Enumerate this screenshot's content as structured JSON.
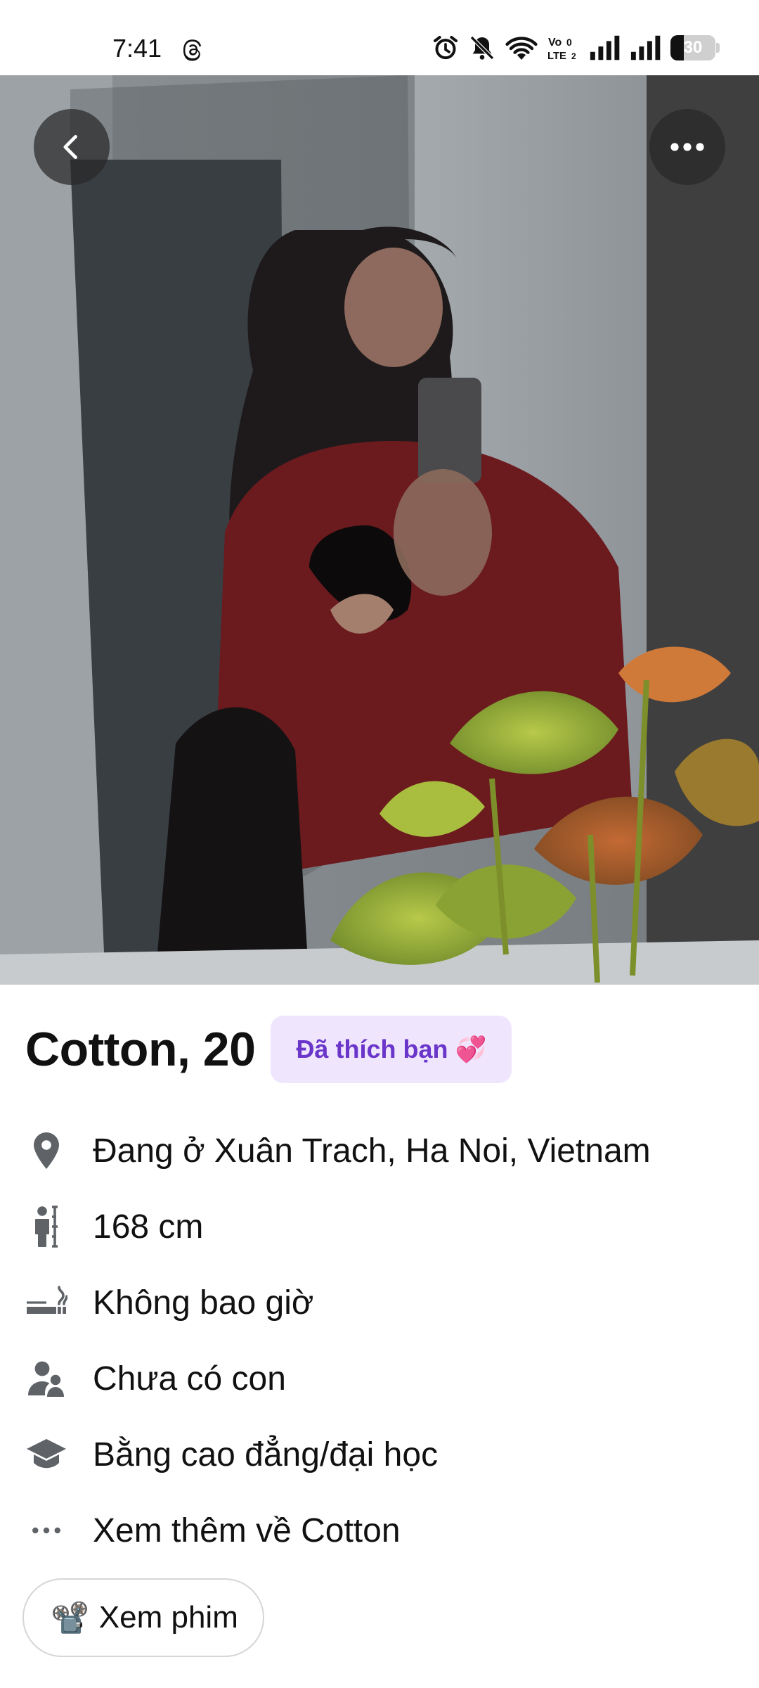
{
  "status_bar": {
    "time": "7:41",
    "battery": "30",
    "battery_level": 0.3,
    "icons": [
      "threads-icon",
      "alarm-icon",
      "mute-icon",
      "wifi-icon",
      "volte-icon",
      "signal-icon",
      "signal-icon",
      "battery-icon"
    ]
  },
  "photo": {
    "back_icon": "chevron-left-icon",
    "more_icon": "more-horizontal-icon"
  },
  "profile": {
    "name_age": "Cotton, 20",
    "liked_badge": "Đã thích bạn",
    "liked_emoji": "💞"
  },
  "details": [
    {
      "icon": "location-pin-icon",
      "text": "Đang ở Xuân Trach, Ha Noi, Vietnam"
    },
    {
      "icon": "height-icon",
      "text": "168 cm"
    },
    {
      "icon": "smoking-icon",
      "text": "Không bao giờ"
    },
    {
      "icon": "children-icon",
      "text": "Chưa có con"
    },
    {
      "icon": "education-cap-icon",
      "text": "Bằng cao đẳng/đại học"
    },
    {
      "icon": "more-dots-icon",
      "text": "Xem thêm về Cotton"
    }
  ],
  "watch_button": {
    "emoji": "📽️",
    "label": "Xem phim"
  },
  "colors": {
    "badge_bg": "#efe6fe",
    "badge_text": "#6a35c9",
    "icon_gray": "#5f6368"
  }
}
